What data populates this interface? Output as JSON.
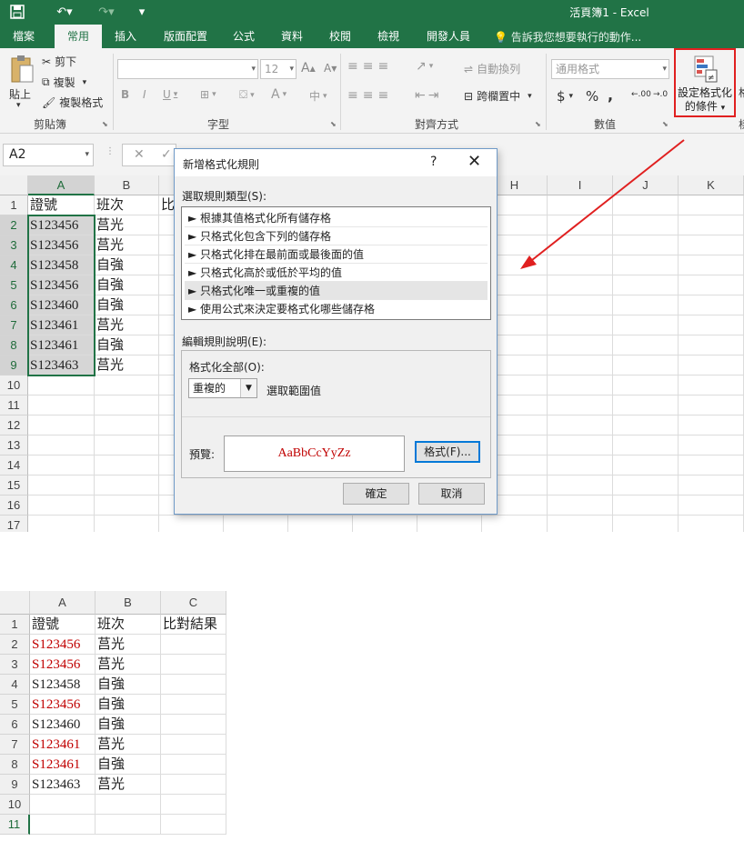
{
  "window": {
    "title": "活頁簿1 - Excel"
  },
  "ribbon_tabs": [
    "檔案",
    "常用",
    "插入",
    "版面配置",
    "公式",
    "資料",
    "校閱",
    "檢視",
    "開發人員"
  ],
  "tell_me": "告訴我您想要執行的動作...",
  "clipboard": {
    "paste": "貼上",
    "cut": "剪下",
    "copy": "複製",
    "format_painter": "複製格式",
    "group": "剪貼簿"
  },
  "font": {
    "size": "12",
    "bold": "B",
    "italic": "I",
    "underline": "U",
    "grow": "A",
    "shrink": "A",
    "color": "A",
    "phonetic": "中",
    "group": "字型"
  },
  "alignment": {
    "wrap": "自動換列",
    "merge": "跨欄置中",
    "group": "對齊方式"
  },
  "number": {
    "format": "通用格式",
    "currency": "$",
    "percent": "%",
    "comma": ",",
    "inc": ".00",
    "dec": ".0",
    "group": "數值"
  },
  "conditional_formatting": {
    "line1": "設定格式化",
    "line2": "的條件"
  },
  "name_box": "A2",
  "fx": "fx",
  "columns": [
    "A",
    "B",
    "C",
    "D",
    "E",
    "F",
    "G",
    "H",
    "I",
    "J",
    "K"
  ],
  "rows": [
    "1",
    "2",
    "3",
    "4",
    "5",
    "6",
    "7",
    "8",
    "9",
    "10",
    "11",
    "12",
    "13",
    "14",
    "15",
    "16",
    "17"
  ],
  "sheet_top": [
    [
      "證號",
      "班次",
      "比"
    ],
    [
      "S123456",
      "莒光",
      ""
    ],
    [
      "S123456",
      "莒光",
      ""
    ],
    [
      "S123458",
      "自強",
      ""
    ],
    [
      "S123456",
      "自強",
      ""
    ],
    [
      "S123460",
      "自強",
      ""
    ],
    [
      "S123461",
      "莒光",
      ""
    ],
    [
      "S123461",
      "自強",
      ""
    ],
    [
      "S123463",
      "莒光",
      ""
    ]
  ],
  "dialog": {
    "title": "新增格式化規則",
    "help": "?",
    "close": "✕",
    "select_rule_type": "選取規則類型(S):",
    "rule_types": [
      "► 根據其值格式化所有儲存格",
      "► 只格式化包含下列的儲存格",
      "► 只格式化排在最前面或最後面的值",
      "► 只格式化高於或低於平均的值",
      "► 只格式化唯一或重複的值",
      "► 使用公式來決定要格式化哪些儲存格"
    ],
    "edit_rule_desc": "編輯規則說明(E):",
    "format_all": "格式化全部(O):",
    "combo_value": "重複的",
    "combo_suffix": "選取範圍值",
    "preview_label": "預覽:",
    "preview_text": "AaBbCcYyZz",
    "format_button": "格式(F)...",
    "ok": "確定",
    "cancel": "取消"
  },
  "sheet_bottom": {
    "columns": [
      "A",
      "B",
      "C"
    ],
    "rows": [
      "1",
      "2",
      "3",
      "4",
      "5",
      "6",
      "7",
      "8",
      "9",
      "10",
      "11"
    ],
    "cells": [
      [
        "證號",
        "班次",
        "比對結果"
      ],
      [
        "S123456",
        "莒光",
        ""
      ],
      [
        "S123456",
        "莒光",
        ""
      ],
      [
        "S123458",
        "自強",
        ""
      ],
      [
        "S123456",
        "自強",
        ""
      ],
      [
        "S123460",
        "自強",
        ""
      ],
      [
        "S123461",
        "莒光",
        ""
      ],
      [
        "S123461",
        "自強",
        ""
      ],
      [
        "S123463",
        "莒光",
        ""
      ],
      [
        "",
        "",
        ""
      ],
      [
        "",
        "",
        ""
      ]
    ],
    "duplicate_rows": [
      1,
      2,
      4,
      6,
      7
    ],
    "duplicate_color": "#c00000"
  },
  "colors": {
    "excel_green": "#217346",
    "highlight_red": "#e02020"
  }
}
